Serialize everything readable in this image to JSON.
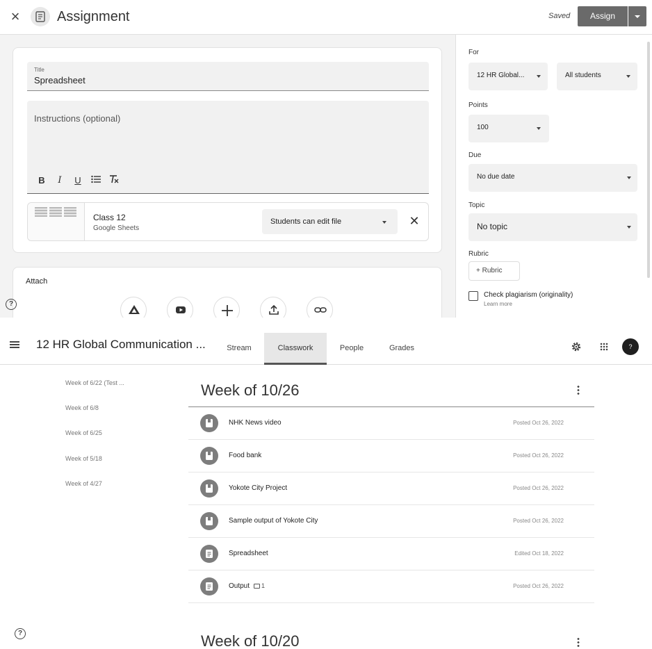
{
  "editor": {
    "header": {
      "title": "Assignment",
      "saved_label": "Saved",
      "assign_label": "Assign"
    },
    "title_field": {
      "label": "Title",
      "value": "Spreadsheet"
    },
    "instructions": {
      "placeholder": "Instructions (optional)"
    },
    "format_buttons": [
      "B",
      "I",
      "U"
    ],
    "attachment": {
      "name": "Class 12",
      "type": "Google Sheets",
      "permission": "Students can edit file"
    },
    "attach_label": "Attach",
    "sidebar": {
      "for_label": "For",
      "class_value": "12 HR Global...",
      "students_value": "All students",
      "points_label": "Points",
      "points_value": "100",
      "due_label": "Due",
      "due_value": "No due date",
      "topic_label": "Topic",
      "topic_value": "No topic",
      "rubric_label": "Rubric",
      "rubric_button": "+ Rubric",
      "plagiarism_label": "Check plagiarism (originality)",
      "learn_more": "Learn more"
    }
  },
  "classwork": {
    "class_name": "12 HR Global Communication ...",
    "tabs": [
      "Stream",
      "Classwork",
      "People",
      "Grades"
    ],
    "active_tab": "Classwork",
    "avatar_letter": "?",
    "topics": [
      "Week of 6/22 (Test ...",
      "Week of 6/8",
      "Week of 6/25",
      "Week of 5/18",
      "Week of 4/27"
    ],
    "weeks": [
      {
        "title": "Week of 10/26",
        "items": [
          {
            "title": "NHK News video",
            "date": "Posted Oct 26, 2022",
            "kind": "material"
          },
          {
            "title": "Food bank",
            "date": "Posted Oct 26, 2022",
            "kind": "material"
          },
          {
            "title": "Yokote City Project",
            "date": "Posted Oct 26, 2022",
            "kind": "material"
          },
          {
            "title": "Sample output of Yokote City",
            "date": "Posted Oct 26, 2022",
            "kind": "material"
          },
          {
            "title": "Spreadsheet",
            "date": "Edited Oct 18, 2022",
            "kind": "assignment"
          },
          {
            "title": "Output",
            "comment_count": "1",
            "date": "Posted Oct 26, 2022",
            "kind": "assignment"
          }
        ]
      },
      {
        "title": "Week of 10/20",
        "items": []
      }
    ]
  },
  "colors": {
    "primary_button": "#6a6a6a",
    "item_icon": "#7d7d7d",
    "field_bg": "#f1f1f1"
  }
}
